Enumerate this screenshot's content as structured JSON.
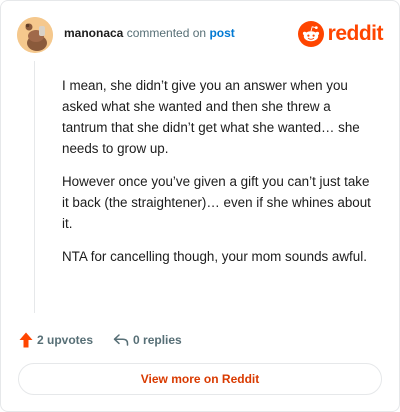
{
  "header": {
    "username": "manonaca",
    "action_text": "commented on",
    "post_link": "post",
    "brand_name": "reddit"
  },
  "comment": {
    "paragraphs": [
      "I mean, she didn’t give you an answer when you asked what she wanted and then she threw a tantrum that she didn’t get what she wanted… she needs to grow up.",
      "However once you’ve given a gift you can’t just take it back (the straightener)… even if she whines about it.",
      "NTA for cancelling though, your mom sounds awful."
    ]
  },
  "actions": {
    "upvotes_label": "2 upvotes",
    "replies_label": "0 replies"
  },
  "footer": {
    "view_more_label": "View more on Reddit"
  },
  "colors": {
    "brand": "#ff4500",
    "link": "#0079d3",
    "upvote": "#ff4500",
    "view_more": "#d93a00"
  },
  "icons": {
    "avatar": "snoo-avatar",
    "brand": "reddit-snoo-logo",
    "upvote": "upvote-arrow-icon",
    "reply": "reply-arrow-icon"
  }
}
